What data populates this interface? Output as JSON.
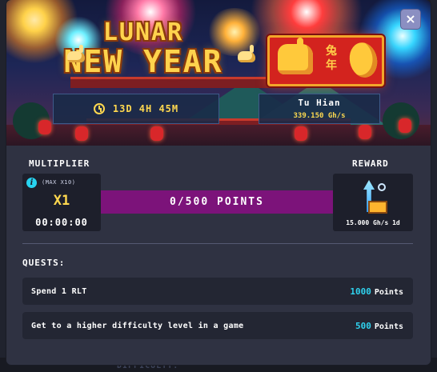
{
  "banner": {
    "title_line1": "LUNAR",
    "title_line2": "NEW YEAR",
    "sign_chars": [
      "兔",
      "年"
    ],
    "timer": "13D 4H 45M",
    "power_name": "Tu Hian",
    "power_value": "339.150 Gh/s"
  },
  "close_label": "×",
  "multiplier": {
    "label": "MULTIPLIER",
    "info_icon": "i",
    "max_text": "(MAX X10)",
    "value": "X1",
    "timer": "00:00:00"
  },
  "progress": {
    "text": "0/500 POINTS",
    "fraction": 0.0
  },
  "reward": {
    "label": "REWARD",
    "value": "15.000 Gh/s 1d"
  },
  "quests": {
    "label": "QUESTS:",
    "items": [
      {
        "name": "Spend 1 RLT",
        "points": "1000",
        "unit": "Points"
      },
      {
        "name": "Get to a higher difficulty level in a game",
        "points": "500",
        "unit": "Points"
      }
    ]
  },
  "background": {
    "bottom_text": "DIFFICULTY:"
  },
  "colors": {
    "gold": "#ffd84f",
    "cyan": "#2fd2ee",
    "magenta": "#b01fae",
    "panel": "#2f3242"
  },
  "icons": [
    "clock-icon",
    "info-icon",
    "close-icon",
    "miner-reward-icon",
    "rabbit-icon"
  ]
}
